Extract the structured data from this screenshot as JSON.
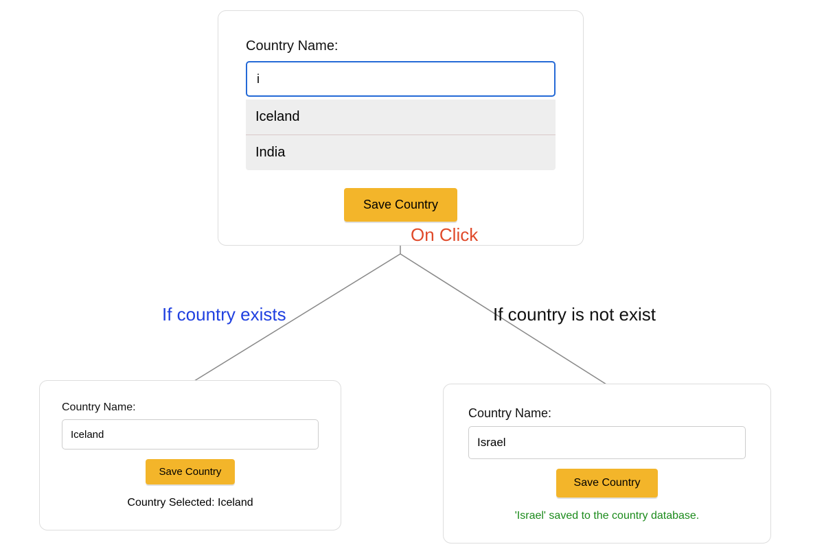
{
  "mainCard": {
    "label": "Country Name:",
    "inputValue": "i",
    "suggestions": [
      "Iceland",
      "India"
    ],
    "button": "Save Country"
  },
  "annotations": {
    "onClick": "On Click",
    "left": "If country exists",
    "right": "If country is not exist"
  },
  "leftCard": {
    "label": "Country Name:",
    "inputValue": "Iceland",
    "button": "Save Country",
    "status": "Country Selected: Iceland"
  },
  "rightCard": {
    "label": "Country Name:",
    "inputValue": "Israel",
    "button": "Save Country",
    "status": "'Israel' saved to the country database."
  }
}
